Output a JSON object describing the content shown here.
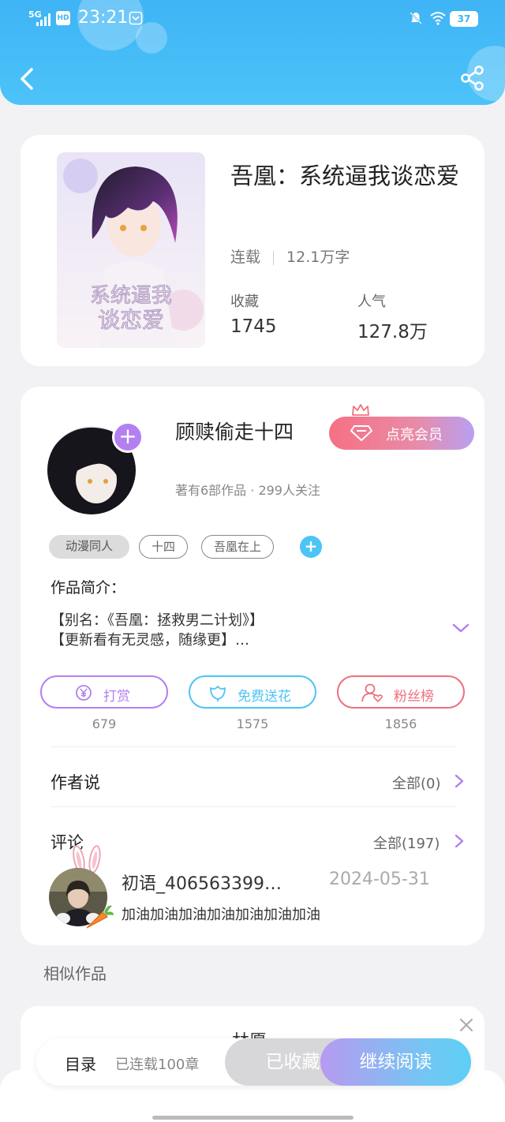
{
  "status_bar": {
    "network": "5G",
    "hd": "HD",
    "time": "23:21",
    "battery": "37"
  },
  "book": {
    "title": "吾凰：系统逼我谈恋爱",
    "status": "连载",
    "word_count": "12.1万字",
    "favorites_label": "收藏",
    "favorites_value": "1745",
    "popularity_label": "人气",
    "popularity_value": "127.8万"
  },
  "author": {
    "name": "顾赎偷走十四",
    "vip_button": "点亮会员",
    "meta": "著有6部作品 · 299人关注",
    "tags": [
      "动漫同人",
      "十四",
      "吾凰在上"
    ],
    "intro_title": "作品简介：",
    "intro_lines": [
      "【别名：《吾凰：拯救男二计划》】",
      "【更新看有无灵感，随缘更】…"
    ]
  },
  "actions": [
    {
      "label": "打赏",
      "count": "679",
      "color": "#b27ff0"
    },
    {
      "label": "免费送花",
      "count": "1575",
      "color": "#4cc4f5"
    },
    {
      "label": "粉丝榜",
      "count": "1856",
      "color": "#ee6f7d"
    }
  ],
  "author_says": {
    "title": "作者说",
    "link": "全部(0)"
  },
  "comments": {
    "title": "评论",
    "link": "全部(197)",
    "first": {
      "user": "初语_406563399…",
      "date": "2024-05-31",
      "text": "加油加油加油加油加油加油加油"
    }
  },
  "similar": {
    "title": "相似作品",
    "first_title": "林愿"
  },
  "bottom_bar": {
    "toc": "目录",
    "toc_sub": "已连载100章",
    "favorited": "已收藏",
    "continue": "继续阅读"
  }
}
